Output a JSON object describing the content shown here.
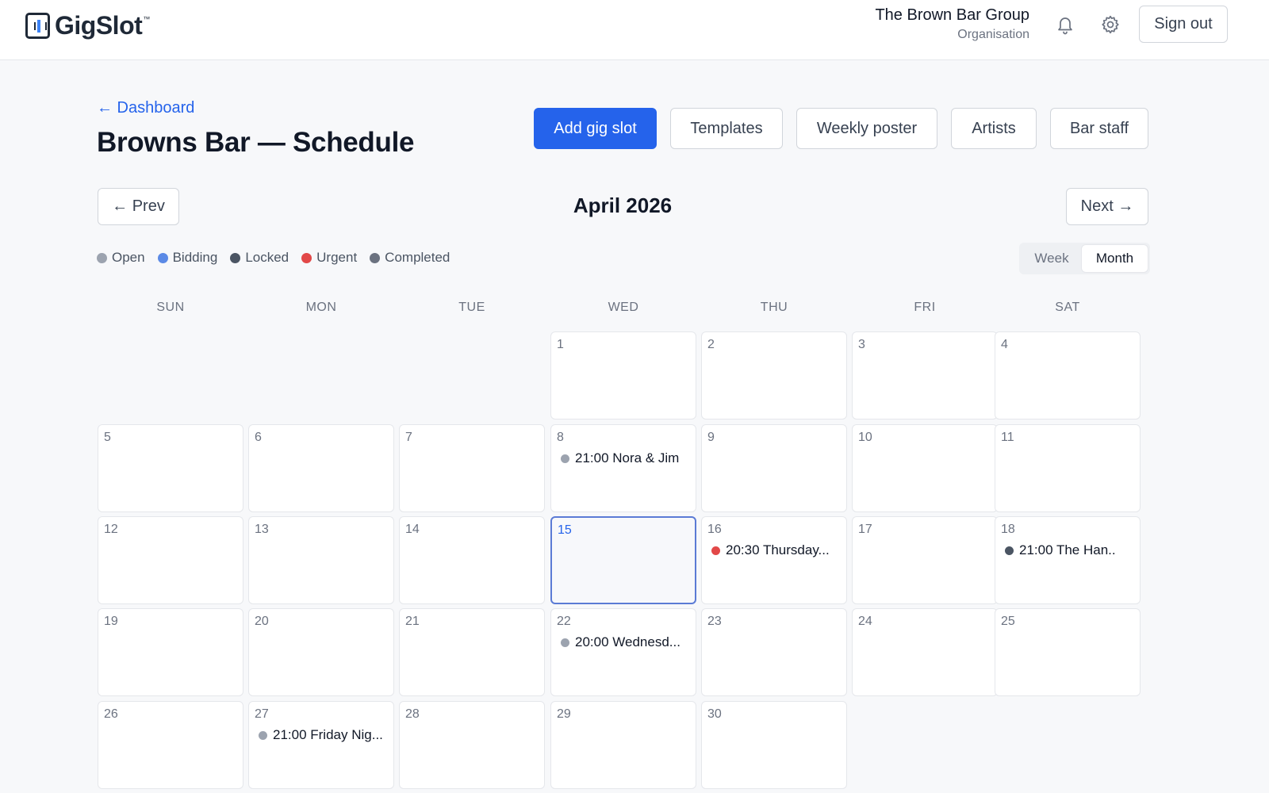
{
  "app": {
    "brand": "GigSlot",
    "tm": "™"
  },
  "header": {
    "org_name": "The Brown Bar Group",
    "org_role": "Organisation",
    "sign_out": "Sign out"
  },
  "page": {
    "back_link": "← Dashboard",
    "title": "Browns Bar — Schedule"
  },
  "actions": {
    "add_gig_slot": "Add gig slot",
    "templates": "Templates",
    "weekly_poster": "Weekly poster",
    "artists": "Artists",
    "bar_staff": "Bar staff"
  },
  "nav": {
    "prev": "← Prev",
    "next": "Next →",
    "month_title": "April 2026"
  },
  "legend": [
    {
      "label": "Open",
      "color": "#9ca3af"
    },
    {
      "label": "Bidding",
      "color": "#5b8ae6"
    },
    {
      "label": "Locked",
      "color": "#4b5563"
    },
    {
      "label": "Urgent",
      "color": "#e24848"
    },
    {
      "label": "Completed",
      "color": "#6b7280"
    }
  ],
  "view": {
    "week": "Week",
    "month": "Month",
    "selected": "Month"
  },
  "calendar": {
    "weekdays": [
      "SUN",
      "MON",
      "TUE",
      "WED",
      "THU",
      "FRI",
      "SAT"
    ],
    "first_weekday_index": 3,
    "days_in_month": 30,
    "today": 15,
    "events": {
      "8": {
        "text": "21:00 Nora & Jim",
        "status": "Open"
      },
      "16": {
        "text": "20:30 Thursday...",
        "status": "Urgent"
      },
      "18": {
        "text": "21:00 The Han..",
        "status": "Locked"
      },
      "22": {
        "text": "20:00 Wednesd...",
        "status": "Open"
      },
      "27": {
        "text": "21:00 Friday Nig...",
        "status": "Open"
      }
    }
  }
}
